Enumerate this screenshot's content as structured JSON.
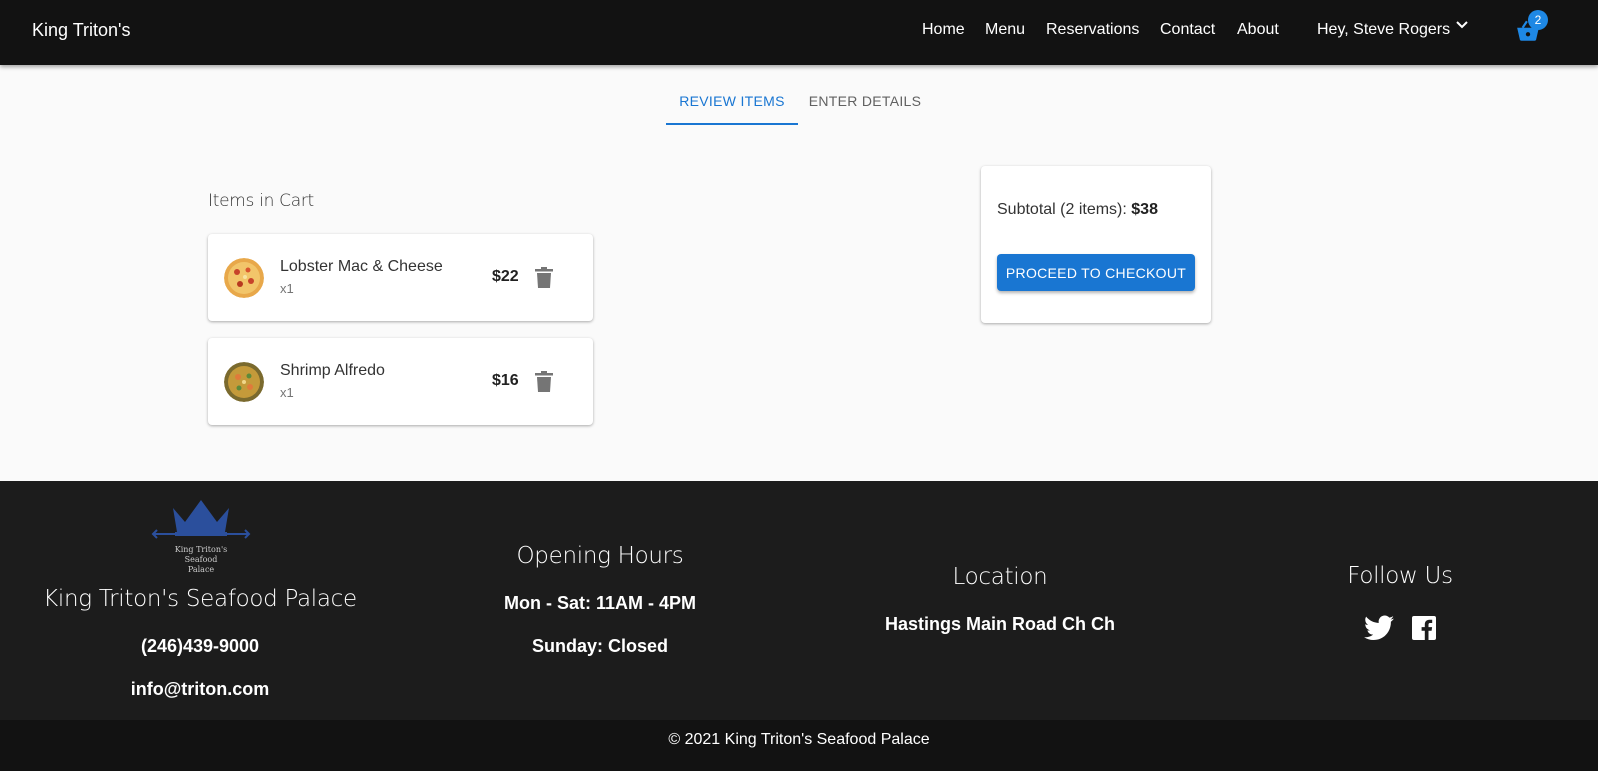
{
  "navbar": {
    "brand": "King Triton's",
    "links": [
      "Home",
      "Menu",
      "Reservations",
      "Contact",
      "About"
    ],
    "user_greeting": "Hey, Steve Rogers",
    "cart_count": "2",
    "cart_icon": "shopping-basket-icon"
  },
  "tabs": {
    "review": "REVIEW ITEMS",
    "details": "ENTER DETAILS"
  },
  "cart": {
    "heading": "Items in Cart",
    "items": [
      {
        "name": "Lobster Mac & Cheese",
        "qty": "x1",
        "price": "$22"
      },
      {
        "name": "Shrimp Alfredo",
        "qty": "x1",
        "price": "$16"
      }
    ]
  },
  "summary": {
    "subtotal_label": "Subtotal (2 items): ",
    "subtotal_value": "$38",
    "checkout_label": "PROCEED TO CHECKOUT"
  },
  "footer": {
    "logo_text": [
      "King Triton's",
      "Seafood",
      "Palace"
    ],
    "name": "King Triton's Seafood Palace",
    "phone": "(246)439-9000",
    "email": "info@triton.com",
    "hours_heading": "Opening Hours",
    "hours_weekday": "Mon - Sat: 11AM - 4PM",
    "hours_sunday": "Sunday: Closed",
    "location_heading": "Location",
    "location": "Hastings Main Road Ch Ch",
    "follow_heading": "Follow Us",
    "copyright": "© 2021 King Triton's Seafood Palace"
  },
  "colors": {
    "primary": "#1976d2",
    "navbar": "#121212",
    "footer": "#1c1c1c",
    "badge": "#1e88e5"
  }
}
